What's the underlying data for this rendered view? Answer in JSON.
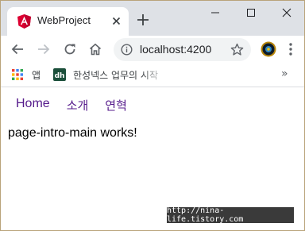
{
  "tab": {
    "title": "WebProject",
    "favicon": "angular-icon"
  },
  "toolbar": {
    "url": "localhost:4200"
  },
  "bookmarks": {
    "apps_label": "앱",
    "site_label": "한성넥스 업무의 시작",
    "more": "»"
  },
  "nav": {
    "items": [
      "Home",
      "소개",
      "연혁"
    ]
  },
  "main": {
    "text": "page-intro-main works!"
  },
  "watermark": {
    "text": "http://nina-life.tistory.com"
  },
  "colors": {
    "tabstrip": "#dee1e6",
    "link_visited": "#551a8b",
    "angular_red": "#dd0031"
  }
}
